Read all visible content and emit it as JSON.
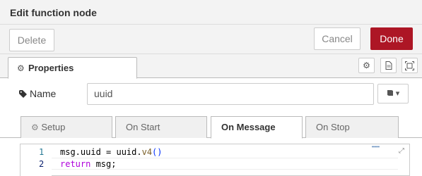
{
  "title": "Edit function node",
  "toolbar": {
    "delete_label": "Delete",
    "cancel_label": "Cancel",
    "done_label": "Done"
  },
  "tabs": {
    "properties_label": "Properties"
  },
  "name": {
    "label": "Name",
    "value": "uuid"
  },
  "subtabs": [
    "Setup",
    "On Start",
    "On Message",
    "On Stop"
  ],
  "active_subtab": "On Message",
  "editor": {
    "lines": [
      {
        "number": "1",
        "code": "msg.uuid = uuid.v4()"
      },
      {
        "number": "2",
        "code": "return msg;"
      }
    ]
  },
  "colors": {
    "accent": "#ad1625",
    "background": "#f3f3f3"
  },
  "icons": [
    "gear-icon",
    "document-icon",
    "frame-icon",
    "tag-icon",
    "book-icon",
    "expand-icon"
  ]
}
